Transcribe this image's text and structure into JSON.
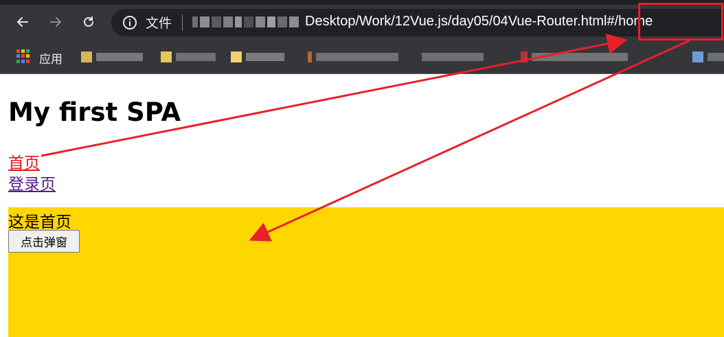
{
  "browser": {
    "address_bar": {
      "file_label": "文件",
      "url_visible": "Desktop/Work/12Vue.js/day05/04Vue-Router.html#/home"
    },
    "bookmarks_bar": {
      "apps_label": "应用"
    }
  },
  "page": {
    "title": "My first SPA",
    "nav": {
      "home_link": "首页",
      "login_link": "登录页"
    },
    "router_view": {
      "text": "这是首页",
      "button_label": "点击弹窗",
      "background": "#ffd700"
    }
  },
  "colors": {
    "annotation": "#e8202a",
    "active_link": "#e8131b",
    "visited_link": "#551a8b"
  },
  "icons": [
    "back-arrow-icon",
    "forward-arrow-icon",
    "reload-icon",
    "info-icon",
    "apps-grid-icon",
    "folder-icon"
  ]
}
